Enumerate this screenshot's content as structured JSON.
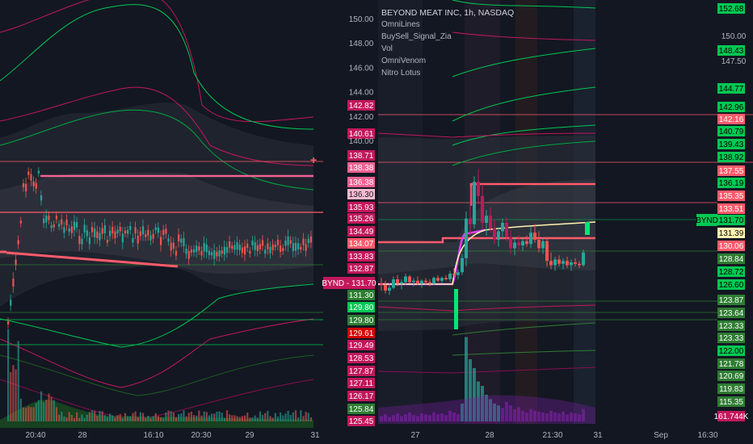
{
  "legend": {
    "title": "BEYOND MEAT INC, 1h, NASDAQ",
    "indicators": [
      "OmniLines",
      "BuySell_Signal_Zia",
      "Vol",
      "OmniVenom",
      "Nitro Lotus"
    ]
  },
  "colors": {
    "background": "#131722",
    "up": "#26a69a",
    "down": "#ef5350",
    "magenta": "#c2185b",
    "green_band": "#00c853",
    "price_line": "#ff5b6b",
    "vwap": "#fff3b0"
  },
  "ticker_tag": {
    "symbol": "BYND",
    "price": "131.70"
  },
  "chart_data": [
    {
      "type": "candlestick",
      "pane": "left",
      "x_ticks": [
        "20:40",
        "28",
        "16:10",
        "20:30",
        "29",
        "31"
      ],
      "level_labels": [
        {
          "text": "142.82",
          "color": "#c2185b"
        },
        {
          "text": "140.61",
          "color": "#c2185b"
        },
        {
          "text": "138.71",
          "color": "#c2185b"
        },
        {
          "text": "138.38",
          "color": "#f06292"
        },
        {
          "text": "136.38",
          "color": "#f06292"
        },
        {
          "text": "136.30",
          "color": "#f8bbd0"
        },
        {
          "text": "135.93",
          "color": "#c2185b"
        },
        {
          "text": "135.26",
          "color": "#c2185b"
        },
        {
          "text": "134.49",
          "color": "#c2185b"
        },
        {
          "text": "134.07",
          "color": "#ff5b6b"
        },
        {
          "text": "133.83",
          "color": "#c2185b"
        },
        {
          "text": "132.87",
          "color": "#c2185b"
        },
        {
          "text": "131.70",
          "color": "#c2185b"
        },
        {
          "text": "131.30",
          "color": "#2e7d32"
        },
        {
          "text": "129.80",
          "color": "#00c853"
        },
        {
          "text": "129.80",
          "color": "#2e7d32"
        },
        {
          "text": "129.61",
          "color": "#d50000"
        },
        {
          "text": "129.49",
          "color": "#c2185b"
        },
        {
          "text": "128.53",
          "color": "#c2185b"
        },
        {
          "text": "127.87",
          "color": "#c2185b"
        },
        {
          "text": "127.11",
          "color": "#c2185b"
        },
        {
          "text": "126.17",
          "color": "#c2185b"
        },
        {
          "text": "125.84",
          "color": "#2e7d32"
        },
        {
          "text": "125.45",
          "color": "#c2185b"
        }
      ]
    },
    {
      "type": "candlestick",
      "pane": "right",
      "x_ticks": [
        "27",
        "28",
        "21:30",
        "31",
        "Sep",
        "16:30"
      ],
      "y_ticks": [
        "150.00",
        "148.00",
        "146.00",
        "144.00",
        "142.00",
        "140.00"
      ],
      "y_ticks_far": [
        "150.00",
        "147.50"
      ],
      "level_labels": [
        {
          "text": "152.68",
          "color": "#00c853"
        },
        {
          "text": "148.43",
          "color": "#00c853"
        },
        {
          "text": "144.77",
          "color": "#00c853"
        },
        {
          "text": "142.96",
          "color": "#00c853"
        },
        {
          "text": "142.16",
          "color": "#ff5b6b"
        },
        {
          "text": "140.79",
          "color": "#00c853"
        },
        {
          "text": "139.43",
          "color": "#00c853"
        },
        {
          "text": "138.92",
          "color": "#00c853"
        },
        {
          "text": "137.55",
          "color": "#ff5b6b"
        },
        {
          "text": "136.19",
          "color": "#00c853"
        },
        {
          "text": "135.35",
          "color": "#ff5b6b"
        },
        {
          "text": "133.51",
          "color": "#ff5b6b"
        },
        {
          "text": "131.70",
          "color": "#00c853"
        },
        {
          "text": "131.39",
          "color": "#fff3b0"
        },
        {
          "text": "130.06",
          "color": "#ff5b6b"
        },
        {
          "text": "128.84",
          "color": "#2e7d32"
        },
        {
          "text": "128.72",
          "color": "#00c853"
        },
        {
          "text": "126.60",
          "color": "#00c853"
        },
        {
          "text": "123.87",
          "color": "#2e7d32"
        },
        {
          "text": "123.64",
          "color": "#2e7d32"
        },
        {
          "text": "123.33",
          "color": "#2e7d32"
        },
        {
          "text": "123.33",
          "color": "#2e7d32"
        },
        {
          "text": "122.00",
          "color": "#00c853"
        },
        {
          "text": "121.78",
          "color": "#2e7d32"
        },
        {
          "text": "120.69",
          "color": "#2e7d32"
        },
        {
          "text": "119.83",
          "color": "#2e7d32"
        },
        {
          "text": "115.35",
          "color": "#2e7d32"
        },
        {
          "text": "161.744K",
          "color": "#c2185b"
        }
      ],
      "candles": [
        {
          "o": 130.4,
          "h": 130.8,
          "l": 129.9,
          "c": 130.3
        },
        {
          "o": 130.3,
          "h": 130.6,
          "l": 129.7,
          "c": 129.9
        },
        {
          "o": 129.9,
          "h": 130.4,
          "l": 129.6,
          "c": 130.1
        },
        {
          "o": 130.1,
          "h": 130.9,
          "l": 130.0,
          "c": 130.7
        },
        {
          "o": 130.7,
          "h": 131.0,
          "l": 130.2,
          "c": 130.4
        },
        {
          "o": 130.4,
          "h": 130.7,
          "l": 130.0,
          "c": 130.5
        },
        {
          "o": 130.5,
          "h": 131.1,
          "l": 130.3,
          "c": 130.9
        },
        {
          "o": 130.9,
          "h": 131.0,
          "l": 130.4,
          "c": 130.5
        },
        {
          "o": 130.5,
          "h": 130.8,
          "l": 130.2,
          "c": 130.6
        },
        {
          "o": 130.6,
          "h": 130.9,
          "l": 130.3,
          "c": 130.4
        },
        {
          "o": 130.4,
          "h": 130.7,
          "l": 130.1,
          "c": 130.6
        },
        {
          "o": 130.6,
          "h": 130.8,
          "l": 130.3,
          "c": 130.5
        },
        {
          "o": 130.5,
          "h": 130.7,
          "l": 130.2,
          "c": 130.4
        },
        {
          "o": 130.4,
          "h": 130.9,
          "l": 130.3,
          "c": 130.8
        },
        {
          "o": 130.8,
          "h": 131.0,
          "l": 130.5,
          "c": 130.6
        },
        {
          "o": 130.6,
          "h": 130.9,
          "l": 130.4,
          "c": 130.8
        },
        {
          "o": 130.8,
          "h": 131.0,
          "l": 130.6,
          "c": 130.7
        },
        {
          "o": 130.7,
          "h": 131.3,
          "l": 130.5,
          "c": 131.1
        },
        {
          "o": 131.1,
          "h": 131.5,
          "l": 130.8,
          "c": 131.0
        },
        {
          "o": 131.0,
          "h": 131.4,
          "l": 130.7,
          "c": 131.2
        },
        {
          "o": 131.2,
          "h": 132.5,
          "l": 131.0,
          "c": 132.2
        },
        {
          "o": 132.2,
          "h": 135.5,
          "l": 131.6,
          "c": 135.0
        },
        {
          "o": 135.0,
          "h": 137.2,
          "l": 133.8,
          "c": 134.6
        },
        {
          "o": 134.6,
          "h": 138.0,
          "l": 134.3,
          "c": 137.6
        },
        {
          "o": 137.6,
          "h": 138.5,
          "l": 136.0,
          "c": 136.6
        },
        {
          "o": 136.6,
          "h": 137.4,
          "l": 134.2,
          "c": 134.7
        },
        {
          "o": 134.7,
          "h": 135.6,
          "l": 133.8,
          "c": 135.2
        },
        {
          "o": 135.2,
          "h": 135.8,
          "l": 134.0,
          "c": 134.3
        },
        {
          "o": 134.3,
          "h": 134.9,
          "l": 133.2,
          "c": 133.5
        },
        {
          "o": 133.5,
          "h": 134.4,
          "l": 133.0,
          "c": 134.1
        },
        {
          "o": 134.1,
          "h": 135.0,
          "l": 133.6,
          "c": 134.7
        },
        {
          "o": 134.7,
          "h": 135.1,
          "l": 133.4,
          "c": 133.7
        },
        {
          "o": 133.7,
          "h": 134.2,
          "l": 132.5,
          "c": 132.9
        },
        {
          "o": 132.9,
          "h": 133.7,
          "l": 132.4,
          "c": 133.3
        },
        {
          "o": 133.3,
          "h": 133.8,
          "l": 132.8,
          "c": 133.1
        },
        {
          "o": 133.1,
          "h": 133.6,
          "l": 132.7,
          "c": 133.4
        },
        {
          "o": 133.4,
          "h": 133.8,
          "l": 133.0,
          "c": 133.2
        },
        {
          "o": 133.2,
          "h": 134.4,
          "l": 132.9,
          "c": 134.0
        },
        {
          "o": 134.0,
          "h": 134.6,
          "l": 133.3,
          "c": 133.5
        },
        {
          "o": 133.5,
          "h": 134.1,
          "l": 132.6,
          "c": 132.9
        },
        {
          "o": 132.9,
          "h": 133.6,
          "l": 132.5,
          "c": 133.4
        },
        {
          "o": 133.4,
          "h": 133.7,
          "l": 131.6,
          "c": 132.0
        },
        {
          "o": 132.0,
          "h": 132.6,
          "l": 131.4,
          "c": 131.7
        },
        {
          "o": 131.7,
          "h": 132.3,
          "l": 131.3,
          "c": 132.1
        },
        {
          "o": 132.1,
          "h": 132.4,
          "l": 131.6,
          "c": 131.8
        },
        {
          "o": 131.8,
          "h": 132.2,
          "l": 131.4,
          "c": 132.0
        },
        {
          "o": 132.0,
          "h": 132.3,
          "l": 131.5,
          "c": 131.7
        },
        {
          "o": 131.7,
          "h": 132.1,
          "l": 131.3,
          "c": 131.9
        },
        {
          "o": 131.9,
          "h": 132.2,
          "l": 131.6,
          "c": 131.8
        },
        {
          "o": 131.8,
          "h": 132.0,
          "l": 131.5,
          "c": 131.7
        },
        {
          "o": 131.7,
          "h": 132.8,
          "l": 131.6,
          "c": 132.6
        }
      ]
    }
  ]
}
